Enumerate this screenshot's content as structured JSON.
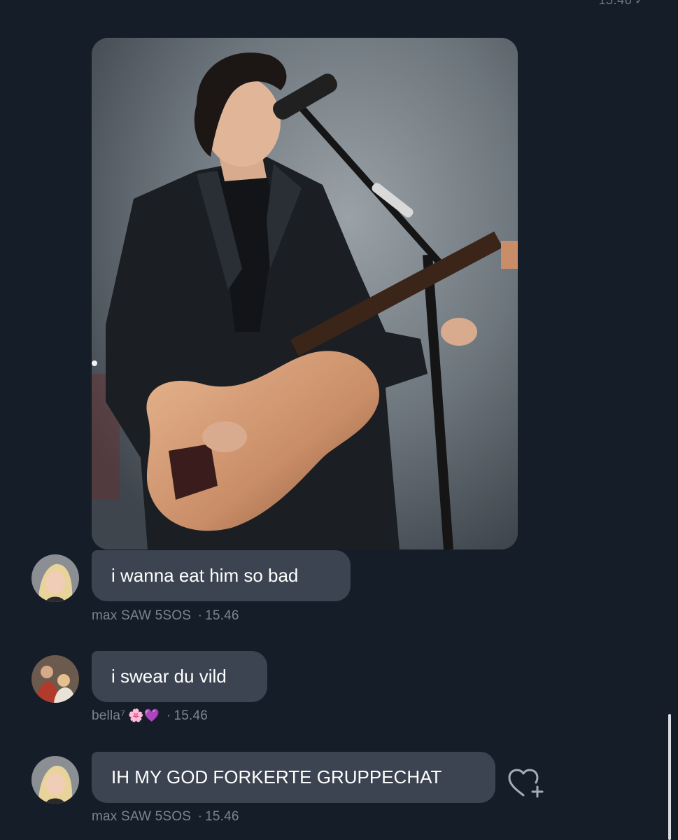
{
  "header": {
    "timestamp": "15.46"
  },
  "media": {
    "alt_icon": "concert-photo"
  },
  "messages": [
    {
      "id": "msg1",
      "text": "i wanna eat him so bad",
      "sender": "max SAW 5SOS",
      "time": "15.46"
    },
    {
      "id": "msg2",
      "text": "i swear du vild",
      "sender": "bella⁷",
      "sender_emojis": "🌸💜",
      "time": "15.46"
    },
    {
      "id": "msg3",
      "text": "IH MY GOD FORKERTE GRUPPECHAT",
      "sender": "max SAW 5SOS",
      "time": "15.46"
    }
  ],
  "meta_separator": "·",
  "icons": {
    "read_check": "✓",
    "react": "heart-add-icon"
  },
  "colors": {
    "background": "#151d28",
    "bubble": "#3b4450",
    "meta_text": "#7b8590"
  }
}
